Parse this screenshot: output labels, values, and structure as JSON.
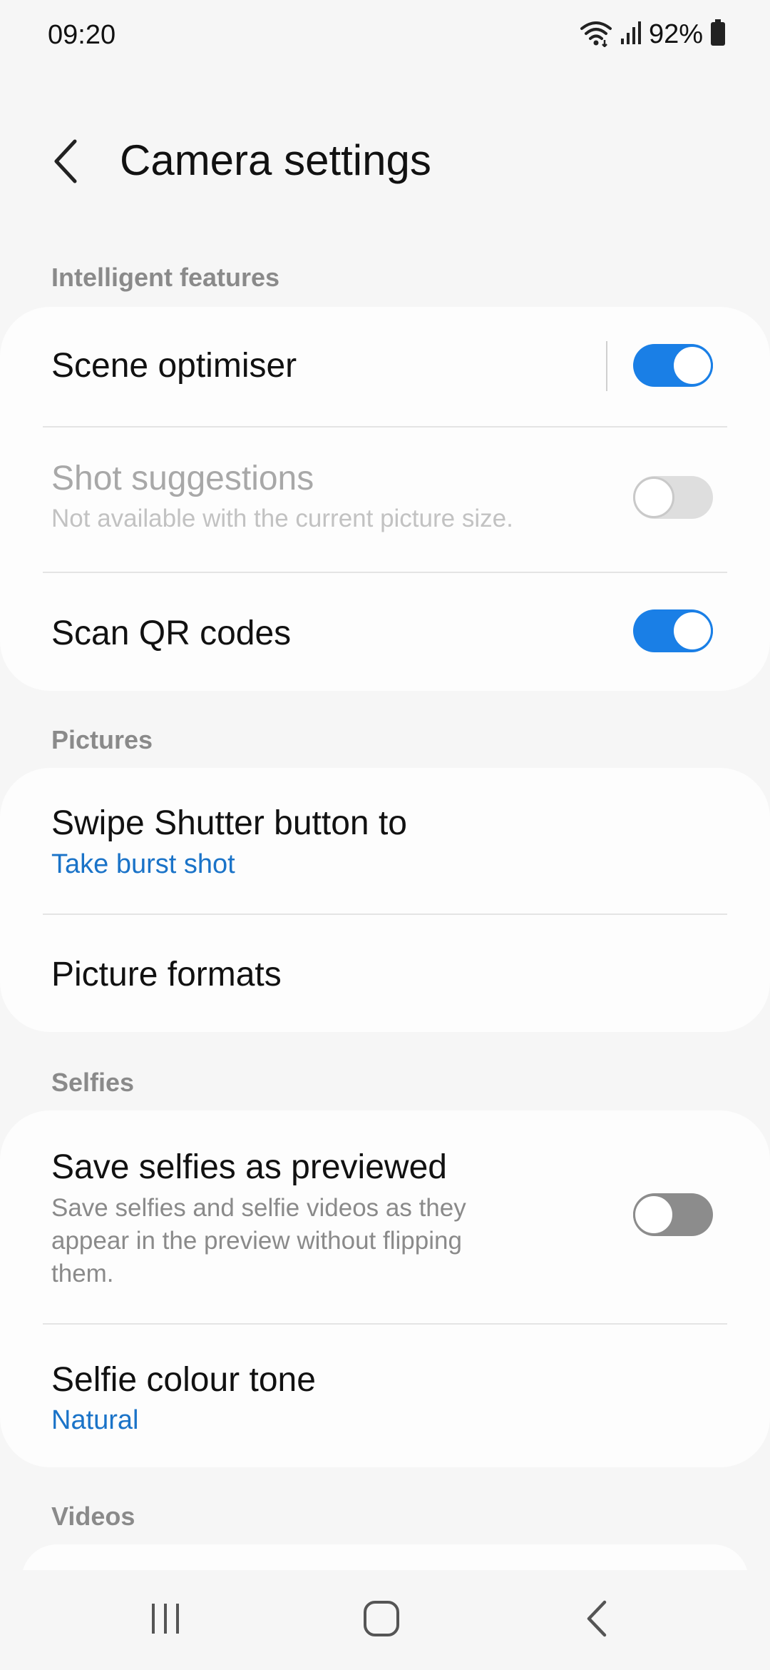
{
  "status_bar": {
    "time": "09:20",
    "battery": "92%",
    "icons": [
      "wifi-icon",
      "signal-icon",
      "battery-icon"
    ]
  },
  "header": {
    "title": "Camera settings",
    "back_icon": "back-chevron-icon"
  },
  "sections": {
    "intelligent": {
      "header": "Intelligent features",
      "scene_optimiser": {
        "title": "Scene optimiser",
        "enabled": true
      },
      "shot_suggestions": {
        "title": "Shot suggestions",
        "subtitle": "Not available with the current picture size.",
        "enabled": false,
        "disabled": true
      },
      "scan_qr": {
        "title": "Scan QR codes",
        "enabled": true
      }
    },
    "pictures": {
      "header": "Pictures",
      "swipe_shutter": {
        "title": "Swipe Shutter button to",
        "value": "Take burst shot"
      },
      "picture_formats": {
        "title": "Picture formats"
      }
    },
    "selfies": {
      "header": "Selfies",
      "save_selfies": {
        "title": "Save selfies as previewed",
        "subtitle_line1": "Save selfies and selfie videos as they",
        "subtitle_line2": "appear in the preview without flipping",
        "subtitle_line3": "them.",
        "enabled": false
      },
      "selfie_tone": {
        "title": "Selfie colour tone",
        "value": "Natural"
      }
    },
    "videos": {
      "header": "Videos"
    }
  },
  "colors": {
    "accent": "#1a7fe6",
    "link": "#1a73c8",
    "background": "#f6f6f6",
    "card": "#fdfdfd"
  },
  "nav": {
    "recents_icon": "recents-icon",
    "home_icon": "home-icon",
    "back_icon": "nav-back-icon"
  }
}
